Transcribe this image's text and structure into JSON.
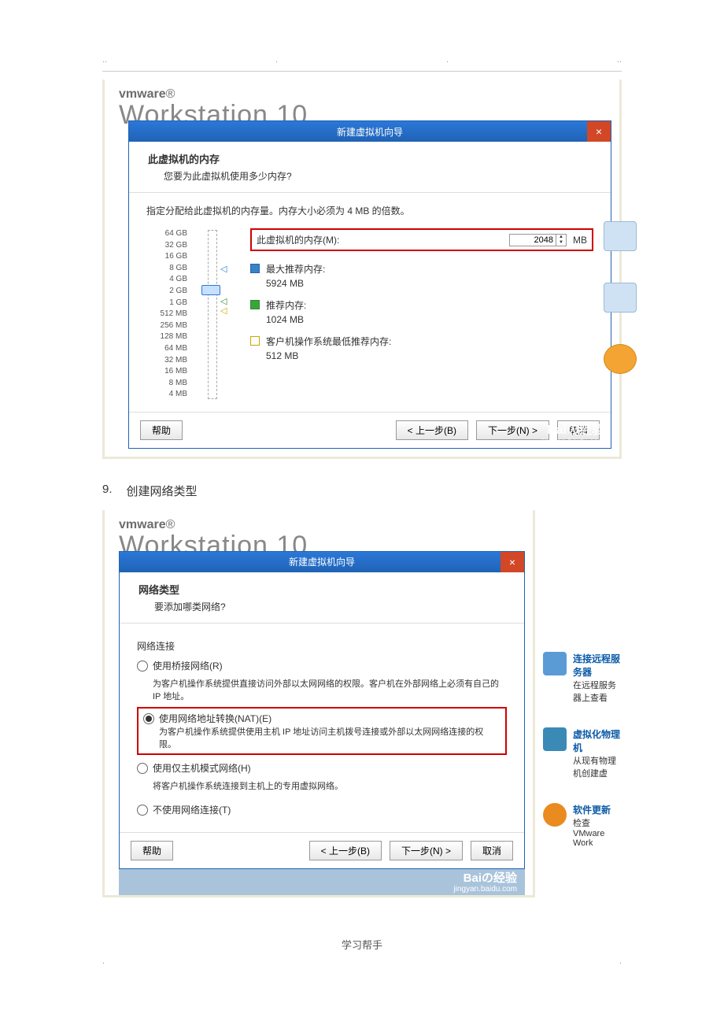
{
  "footer": "学习帮手",
  "step": {
    "num": "9.",
    "text": "创建网络类型"
  },
  "brand": {
    "vm": "vmware",
    "ws": "Workstation 10"
  },
  "dlg1": {
    "title": "新建虚拟机向导",
    "head": {
      "title": "此虚拟机的内存",
      "sub": "您要为此虚拟机使用多少内存?"
    },
    "desc": "指定分配给此虚拟机的内存量。内存大小必须为 4 MB 的倍数。",
    "mem_label": "此虚拟机的内存(M):",
    "mem_value": "2048",
    "mem_unit": "MB",
    "ticks": [
      "64 GB",
      "32 GB",
      "16 GB",
      "8 GB",
      "4 GB",
      "2 GB",
      "1 GB",
      "512 MB",
      "256 MB",
      "128 MB",
      "64 MB",
      "32 MB",
      "16 MB",
      "8 MB",
      "4 MB"
    ],
    "rec": [
      {
        "label": "最大推荐内存:",
        "value": "5924 MB"
      },
      {
        "label": "推荐内存:",
        "value": "1024 MB"
      },
      {
        "label": "客户机操作系统最低推荐内存:",
        "value": "512 MB"
      }
    ],
    "buttons": {
      "help": "帮助",
      "back": "< 上一步(B)",
      "next": "下一步(N) >",
      "cancel": "取消"
    }
  },
  "dlg2": {
    "title": "新建虚拟机向导",
    "head": {
      "title": "网络类型",
      "sub": "要添加哪类网络?"
    },
    "section": "网络连接",
    "opts": [
      {
        "label": "使用桥接网络(R)",
        "desc": "为客户机操作系统提供直接访问外部以太网网络的权限。客户机在外部网络上必须有自己的 IP 地址。",
        "sel": false
      },
      {
        "label": "使用网络地址转换(NAT)(E)",
        "desc": "为客户机操作系统提供使用主机 IP 地址访问主机拨号连接或外部以太网网络连接的权限。",
        "sel": true
      },
      {
        "label": "使用仅主机模式网络(H)",
        "desc": "将客户机操作系统连接到主机上的专用虚拟网络。",
        "sel": false
      },
      {
        "label": "不使用网络连接(T)",
        "desc": "",
        "sel": false
      }
    ],
    "buttons": {
      "help": "帮助",
      "back": "< 上一步(B)",
      "next": "下一步(N) >",
      "cancel": "取消"
    }
  },
  "side": [
    {
      "title": "连接远程服务器",
      "sub": "在远程服务器上查看"
    },
    {
      "title": "虚拟化物理机",
      "sub": "从现有物理机创建虚"
    },
    {
      "title": "软件更新",
      "sub": "检查 VMware Work"
    }
  ],
  "watermark": {
    "brand": "Baiの经验",
    "url": "jingyan.baidu.com"
  }
}
